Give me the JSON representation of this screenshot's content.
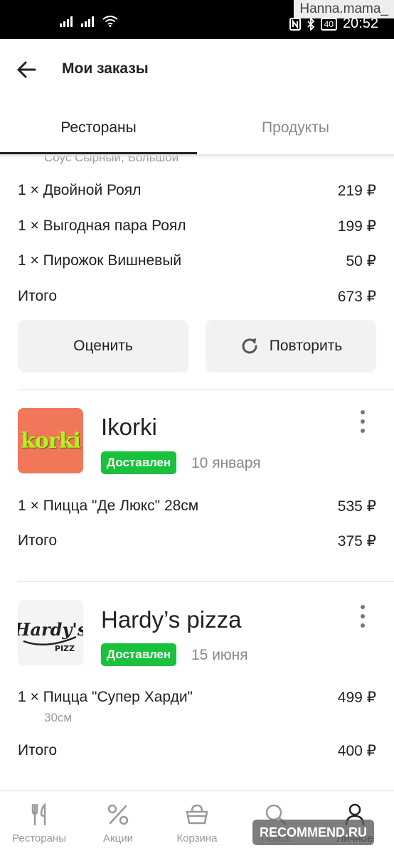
{
  "status_bar": {
    "time": "20:52",
    "battery": "40",
    "watermark_user": "Hanna.mama_"
  },
  "header": {
    "title": "Мои заказы"
  },
  "tabs": [
    {
      "label": "Рестораны",
      "active": true
    },
    {
      "label": "Продукты",
      "active": false
    }
  ],
  "order1": {
    "modifier_text": "Соус Сырный, Большой",
    "items": [
      {
        "name": "1 × Двойной Роял",
        "price": "219 ₽"
      },
      {
        "name": "1 × Выгодная пара Роял",
        "price": "199 ₽"
      },
      {
        "name": "1 × Пирожок Вишневый",
        "price": "50 ₽"
      }
    ],
    "total_label": "Итого",
    "total": "673 ₽",
    "rate_button": "Оценить",
    "repeat_button": "Повторить"
  },
  "order2": {
    "restaurant": "Ikorki",
    "logo_text": "korki",
    "status": "Доставлен",
    "date": "10 января",
    "items": [
      {
        "name": "1 × Пицца \"Де Люкс\" 28см",
        "price": "535 ₽"
      }
    ],
    "total_label": "Итого",
    "total": "375 ₽"
  },
  "order3": {
    "restaurant": "Hardy’s pizza",
    "logo_text": "Hardy's",
    "logo_subtext": "PIZZ",
    "status": "Доставлен",
    "date": "15 июня",
    "items": [
      {
        "name": "1 × Пицца \"Супер Харди\"",
        "price": "499 ₽",
        "modifier": "30см"
      }
    ],
    "total_label": "Итого",
    "total": "400 ₽"
  },
  "bottom_nav": [
    {
      "label": "Рестораны",
      "icon": "fork-knife-icon",
      "active": false
    },
    {
      "label": "Акции",
      "icon": "percent-icon",
      "active": false
    },
    {
      "label": "Корзина",
      "icon": "basket-icon",
      "active": false
    },
    {
      "label": "Поиск",
      "icon": "search-icon",
      "active": false
    },
    {
      "label": "Личное",
      "icon": "person-icon",
      "active": true
    }
  ],
  "overlay": {
    "recommend_watermark": "RECOMMEND.RU"
  },
  "colors": {
    "status_green": "#19c13c",
    "button_bg": "#f2f2f2",
    "text_primary": "#222222",
    "text_secondary": "#888888"
  }
}
